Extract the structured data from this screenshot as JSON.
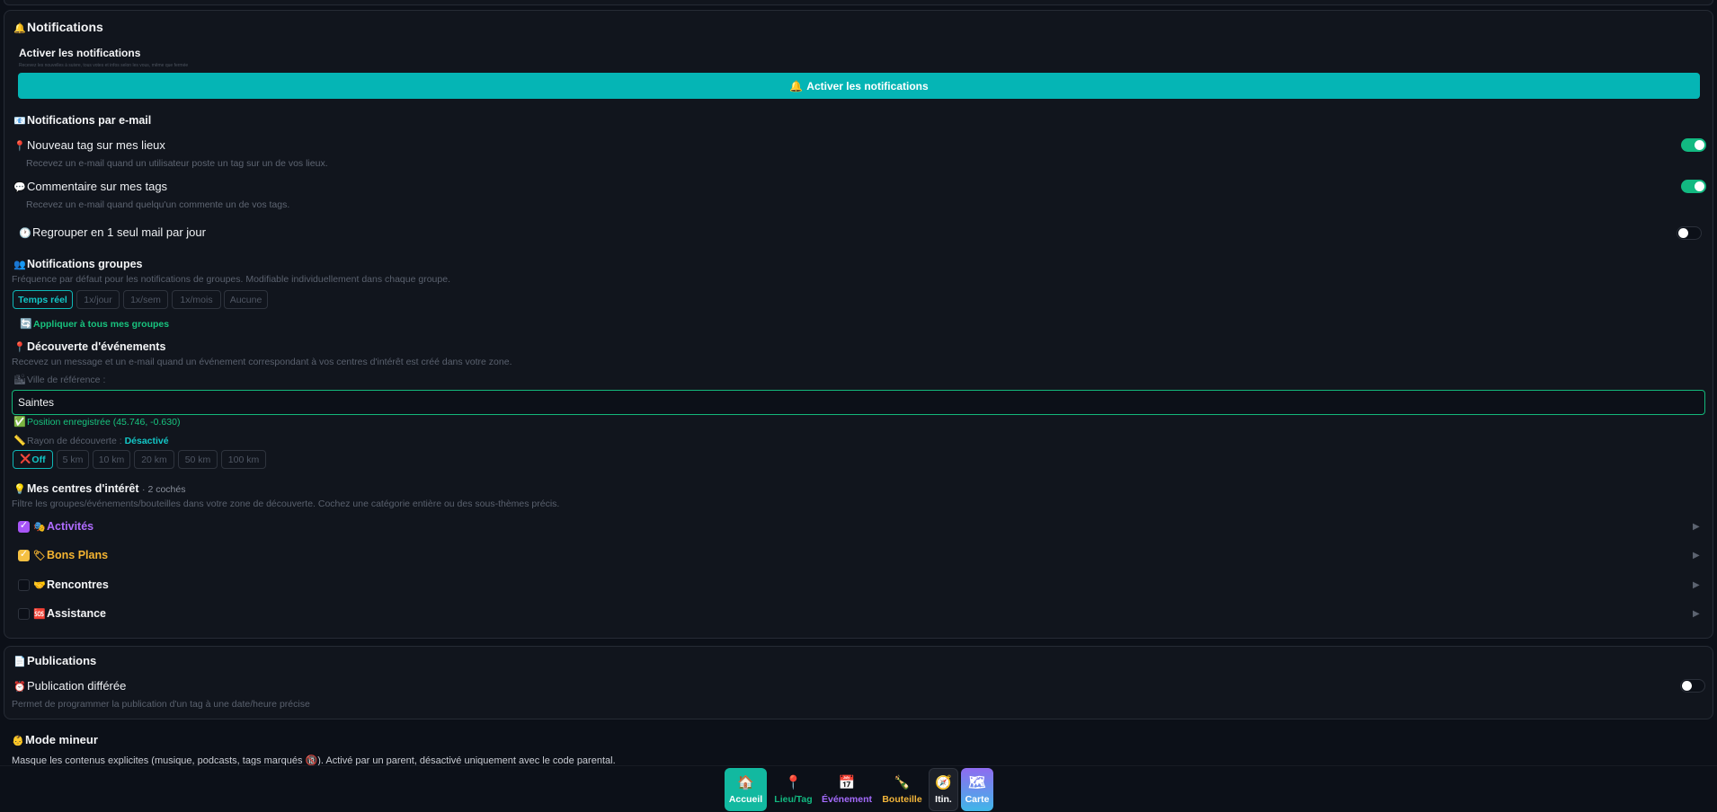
{
  "notifications": {
    "title": "Notifications",
    "title_icon": "🔔",
    "push": {
      "title": "Activer les notifications",
      "description": "Recevez les nouvelles à suivre, tous votes et infos selon les vous, même que fermée",
      "button_label": "Activer les notifications",
      "button_icon": "🔔",
      "accent": "#05b5b5"
    },
    "email": {
      "title": "Notifications par e-mail",
      "title_icon": "📧",
      "options": [
        {
          "icon": "📍",
          "label": "Nouveau tag sur mes lieux",
          "description": "Recevez un e-mail quand un utilisateur poste un tag sur un de vos lieux.",
          "enabled": true
        },
        {
          "icon": "💬",
          "label": "Commentaire sur mes tags",
          "description": "Recevez un e-mail quand quelqu'un commente un de vos tags.",
          "enabled": true
        }
      ],
      "digest": {
        "icon": "🕐",
        "label": "Regrouper en 1 seul mail par jour",
        "enabled": false
      }
    },
    "groups": {
      "title": "Notifications groupes",
      "title_icon": "👥",
      "description": "Fréquence par défaut pour les notifications de groupes. Modifiable individuellement dans chaque groupe.",
      "frequencies": [
        "Temps réel",
        "1x/jour",
        "1x/sem",
        "1x/mois",
        "Aucune"
      ],
      "selected": "Temps réel",
      "apply_icon": "🔄",
      "apply_label": "Appliquer à tous mes groupes"
    },
    "discovery": {
      "title": "Découverte d'événements",
      "title_icon": "📍",
      "description": "Recevez un message et un e-mail quand un événement correspondant à vos centres d'intérêt est créé dans votre zone.",
      "city_label": "Ville de référence :",
      "city_icon": "🏙",
      "city_value": "Saintes",
      "position_icon": "✅",
      "position_text": "Position enregistrée (45.746, -0.630)",
      "radius_icon": "📏",
      "radius_label": "Rayon de découverte :",
      "radius_state": "Désactivé",
      "radius_options": [
        "Off",
        "5 km",
        "10 km",
        "20 km",
        "50 km",
        "100 km"
      ],
      "radius_off_icon": "❌",
      "radius_selected": "Off"
    },
    "interests": {
      "title": "Mes centres d'intérêt",
      "title_icon": "💡",
      "count_text": "· 2 cochés",
      "description": "Filtre les groupes/événements/bouteilles dans votre zone de découverte. Cochez une catégorie entière ou des sous-thèmes précis.",
      "categories": [
        {
          "icon": "🎭",
          "label": "Activités",
          "state": "checked",
          "color": "#b06cff"
        },
        {
          "icon": "🏷",
          "label": "Bons Plans",
          "state": "partial",
          "color": "#f5b431"
        },
        {
          "icon": "🤝",
          "label": "Rencontres",
          "state": "empty",
          "color": "#f3f4f6"
        },
        {
          "icon": "🆘",
          "label": "Assistance",
          "state": "empty",
          "color": "#f3f4f6"
        }
      ]
    }
  },
  "publications": {
    "title": "Publications",
    "title_icon": "📄",
    "delayed": {
      "icon": "⏰",
      "label": "Publication différée",
      "description": "Permet de programmer la publication d'un tag à une date/heure précise",
      "enabled": false
    }
  },
  "minor_mode": {
    "title": "Mode mineur",
    "title_icon": "👶",
    "description_before": "Masque les contenus explicites (musique, podcasts, tags marqués ",
    "description_icon": "🔞",
    "description_after": "). Activé par un parent, désactivé uniquement avec le code parental."
  },
  "bottom_nav": [
    {
      "icon": "🏠",
      "label": "Accueil",
      "color": "#ffffff",
      "bg": "#12b9a0"
    },
    {
      "icon": "📍",
      "label": "Lieu/Tag",
      "color": "#12b981",
      "bg": ""
    },
    {
      "icon": "📅",
      "label": "Événement",
      "color": "#a56bff",
      "bg": ""
    },
    {
      "icon": "🍾",
      "label": "Bouteille",
      "color": "#f2b53a",
      "bg": ""
    },
    {
      "icon": "🧭",
      "label": "Itin.",
      "color": "#ffffff",
      "bg": "#1c2029"
    },
    {
      "icon": "🗺",
      "label": "Carte",
      "color": "#ffffff",
      "bg": "#5b8cf0"
    }
  ]
}
